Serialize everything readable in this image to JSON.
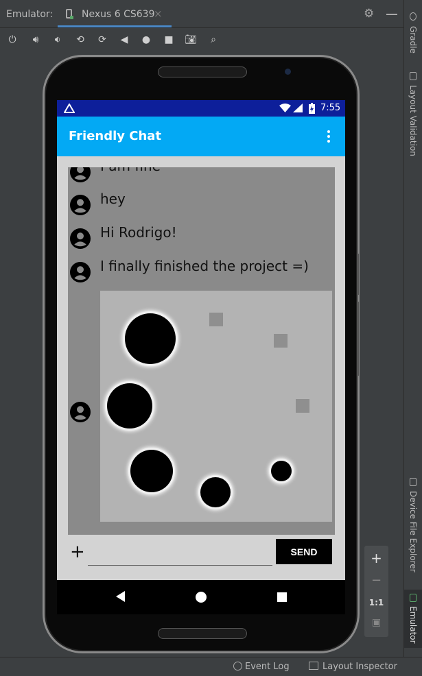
{
  "ide": {
    "window_label": "Emulator:",
    "device_tab": "Nexus 6 CS639",
    "close_glyph": "×",
    "settings_icon": "gear-icon",
    "toolbar_icons": [
      "power-icon",
      "volume-up-icon",
      "volume-down-icon",
      "rotate-left-icon",
      "rotate-right-icon",
      "back-icon",
      "home-icon",
      "overview-icon",
      "screenshot-icon",
      "zoom-icon"
    ],
    "right_tabs": {
      "gradle": "Gradle",
      "layout_validation": "Layout Validation",
      "device_file_explorer": "Device File Explorer",
      "emulator": "Emulator"
    },
    "status_bar": {
      "event_log": "Event Log",
      "layout_inspector": "Layout Inspector"
    },
    "zoom_controls": {
      "plus": "+",
      "minus": "−",
      "one_to_one": "1:1"
    }
  },
  "device": {
    "status": {
      "time": "7:55"
    },
    "app": {
      "title": "Friendly Chat",
      "messages": [
        {
          "text": "I am fine",
          "type": "text"
        },
        {
          "text": "hey",
          "type": "text"
        },
        {
          "text": "Hi Rodrigo!",
          "type": "text"
        },
        {
          "text": "I finally finished the project =)",
          "type": "text"
        },
        {
          "type": "image"
        }
      ],
      "input": {
        "value": "",
        "plus_label": "+",
        "send_label": "SEND"
      }
    }
  }
}
